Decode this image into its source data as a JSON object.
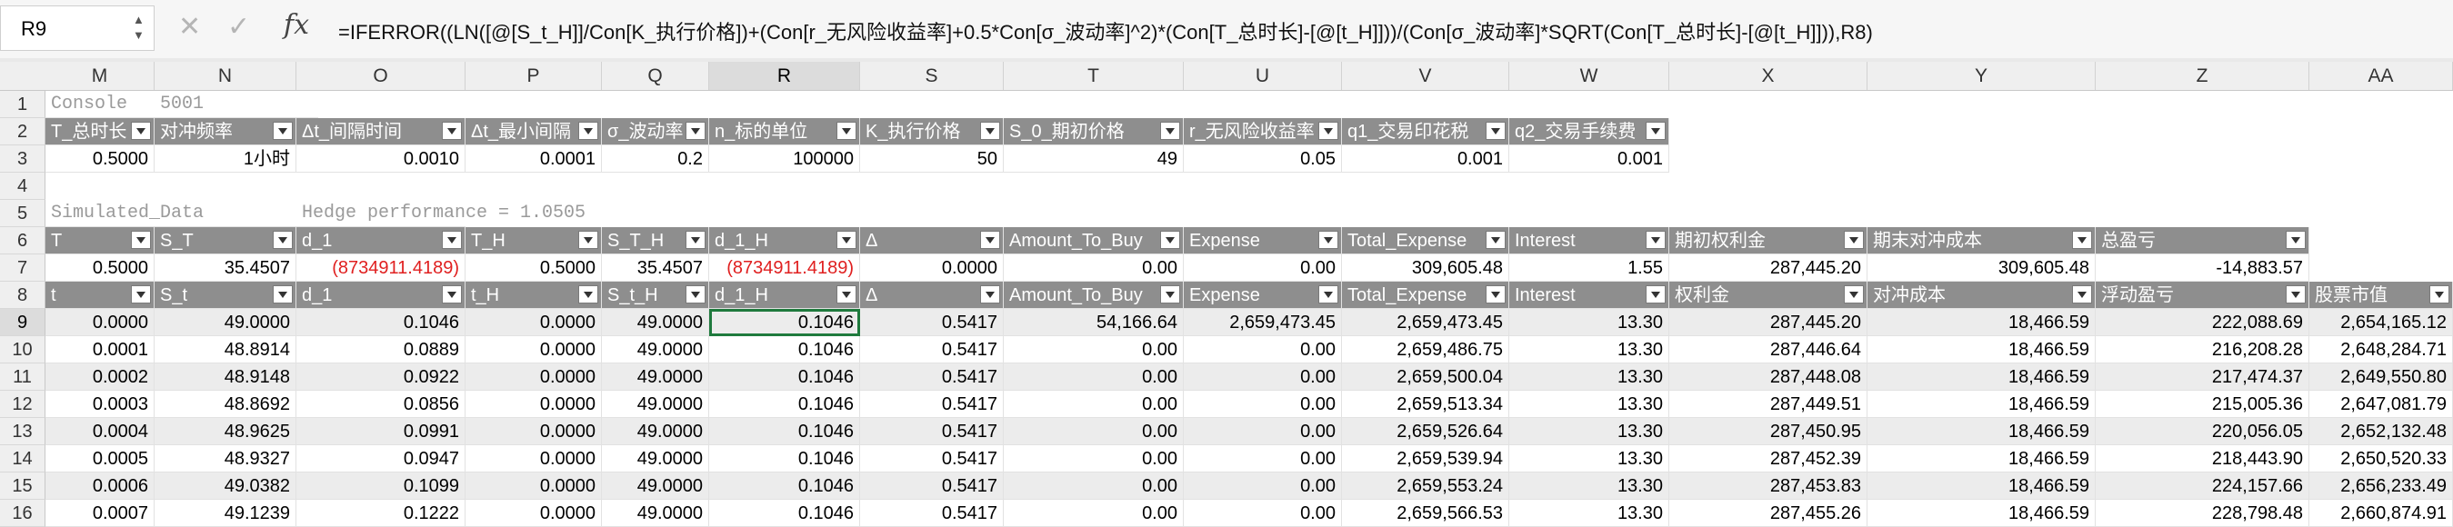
{
  "name_box": "R9",
  "formula_bar": {
    "cancel_glyph": "✕",
    "enter_glyph": "✓",
    "fx_label": "fx",
    "formula": "=IFERROR((LN([@[S_t_H]]/Con[K_执行价格])+(Con[r_无风险收益率]+0.5*Con[σ_波动率]^2)*(Con[T_总时长]-[@[t_H]]))/(Con[σ_波动率]*SQRT(Con[T_总时长]-[@[t_H]])),R8)"
  },
  "columns": [
    "M",
    "N",
    "O",
    "P",
    "Q",
    "R",
    "S",
    "T",
    "U",
    "V",
    "W",
    "X",
    "Y",
    "Z",
    "AA"
  ],
  "selected_column": "R",
  "rows": [
    {
      "num": "1",
      "cells": [
        {
          "col": "M",
          "text": "Console",
          "style": "mono"
        },
        {
          "col": "N",
          "text": "5001",
          "style": "mono"
        }
      ]
    },
    {
      "num": "2",
      "cells": [
        {
          "col": "M",
          "text": "T_总时长",
          "style": "hdr"
        },
        {
          "col": "N",
          "text": "对冲频率",
          "style": "hdr"
        },
        {
          "col": "O",
          "text": "Δt_间隔时间",
          "style": "hdr"
        },
        {
          "col": "P",
          "text": "Δt_最小间隔",
          "style": "hdr"
        },
        {
          "col": "Q",
          "text": "σ_波动率",
          "style": "hdr"
        },
        {
          "col": "R",
          "text": "n_标的单位",
          "style": "hdr"
        },
        {
          "col": "S",
          "text": "K_执行价格",
          "style": "hdr"
        },
        {
          "col": "T",
          "text": "S_0_期初价格",
          "style": "hdr"
        },
        {
          "col": "U",
          "text": "r_无风险收益率",
          "style": "hdr"
        },
        {
          "col": "V",
          "text": "q1_交易印花税",
          "style": "hdr"
        },
        {
          "col": "W",
          "text": "q2_交易手续费",
          "style": "hdr"
        }
      ]
    },
    {
      "num": "3",
      "cells": [
        {
          "col": "M",
          "text": "0.5000",
          "style": "num"
        },
        {
          "col": "N",
          "text": "1小时",
          "style": "num"
        },
        {
          "col": "O",
          "text": "0.0010",
          "style": "num"
        },
        {
          "col": "P",
          "text": "0.0001",
          "style": "num"
        },
        {
          "col": "Q",
          "text": "0.2",
          "style": "num"
        },
        {
          "col": "R",
          "text": "100000",
          "style": "num"
        },
        {
          "col": "S",
          "text": "50",
          "style": "num"
        },
        {
          "col": "T",
          "text": "49",
          "style": "num"
        },
        {
          "col": "U",
          "text": "0.05",
          "style": "num"
        },
        {
          "col": "V",
          "text": "0.001",
          "style": "num"
        },
        {
          "col": "W",
          "text": "0.001",
          "style": "num"
        }
      ]
    },
    {
      "num": "4",
      "cells": []
    },
    {
      "num": "5",
      "cells": [
        {
          "col": "M",
          "text": "Simulated_Data",
          "style": "mono"
        },
        {
          "col": "O",
          "text": "Hedge performance = 1.0505",
          "style": "mono"
        }
      ]
    },
    {
      "num": "6",
      "cells": [
        {
          "col": "M",
          "text": "T",
          "style": "hdr"
        },
        {
          "col": "N",
          "text": "S_T",
          "style": "hdr"
        },
        {
          "col": "O",
          "text": "d_1",
          "style": "hdr"
        },
        {
          "col": "P",
          "text": "T_H",
          "style": "hdr"
        },
        {
          "col": "Q",
          "text": "S_T_H",
          "style": "hdr"
        },
        {
          "col": "R",
          "text": "d_1_H",
          "style": "hdr"
        },
        {
          "col": "S",
          "text": "Δ",
          "style": "hdr"
        },
        {
          "col": "T",
          "text": "Amount_To_Buy",
          "style": "hdr"
        },
        {
          "col": "U",
          "text": "Expense",
          "style": "hdr"
        },
        {
          "col": "V",
          "text": "Total_Expense",
          "style": "hdr"
        },
        {
          "col": "W",
          "text": "Interest",
          "style": "hdr"
        },
        {
          "col": "X",
          "text": "期初权利金",
          "style": "hdr"
        },
        {
          "col": "Y",
          "text": "期末对冲成本",
          "style": "hdr"
        },
        {
          "col": "Z",
          "text": "总盈亏",
          "style": "hdr"
        }
      ]
    },
    {
      "num": "7",
      "cells": [
        {
          "col": "M",
          "text": "0.5000",
          "style": "num"
        },
        {
          "col": "N",
          "text": "35.4507",
          "style": "num"
        },
        {
          "col": "O",
          "text": "(8734911.4189)",
          "style": "red"
        },
        {
          "col": "P",
          "text": "0.5000",
          "style": "num"
        },
        {
          "col": "Q",
          "text": "35.4507",
          "style": "num"
        },
        {
          "col": "R",
          "text": "(8734911.4189)",
          "style": "red"
        },
        {
          "col": "S",
          "text": "0.0000",
          "style": "num"
        },
        {
          "col": "T",
          "text": "0.00",
          "style": "num"
        },
        {
          "col": "U",
          "text": "0.00",
          "style": "num"
        },
        {
          "col": "V",
          "text": "309,605.48",
          "style": "num"
        },
        {
          "col": "W",
          "text": "1.55",
          "style": "num"
        },
        {
          "col": "X",
          "text": "287,445.20",
          "style": "num"
        },
        {
          "col": "Y",
          "text": "309,605.48",
          "style": "num"
        },
        {
          "col": "Z",
          "text": "-14,883.57",
          "style": "num"
        }
      ]
    },
    {
      "num": "8",
      "cells": [
        {
          "col": "M",
          "text": "t",
          "style": "hdr"
        },
        {
          "col": "N",
          "text": "S_t",
          "style": "hdr"
        },
        {
          "col": "O",
          "text": "d_1",
          "style": "hdr"
        },
        {
          "col": "P",
          "text": "t_H",
          "style": "hdr"
        },
        {
          "col": "Q",
          "text": "S_t_H",
          "style": "hdr"
        },
        {
          "col": "R",
          "text": "d_1_H",
          "style": "hdr"
        },
        {
          "col": "S",
          "text": "Δ",
          "style": "hdr"
        },
        {
          "col": "T",
          "text": "Amount_To_Buy",
          "style": "hdr"
        },
        {
          "col": "U",
          "text": "Expense",
          "style": "hdr"
        },
        {
          "col": "V",
          "text": "Total_Expense",
          "style": "hdr"
        },
        {
          "col": "W",
          "text": "Interest",
          "style": "hdr"
        },
        {
          "col": "X",
          "text": "权利金",
          "style": "hdr"
        },
        {
          "col": "Y",
          "text": "对冲成本",
          "style": "hdr"
        },
        {
          "col": "Z",
          "text": "浮动盈亏",
          "style": "hdr"
        },
        {
          "col": "AA",
          "text": "股票市值",
          "style": "hdr"
        }
      ]
    },
    {
      "num": "9",
      "band": true,
      "cells": [
        {
          "col": "M",
          "text": "0.0000"
        },
        {
          "col": "N",
          "text": "49.0000"
        },
        {
          "col": "O",
          "text": "0.1046"
        },
        {
          "col": "P",
          "text": "0.0000"
        },
        {
          "col": "Q",
          "text": "49.0000"
        },
        {
          "col": "R",
          "text": "0.1046",
          "active": true
        },
        {
          "col": "S",
          "text": "0.5417"
        },
        {
          "col": "T",
          "text": "54,166.64"
        },
        {
          "col": "U",
          "text": "2,659,473.45"
        },
        {
          "col": "V",
          "text": "2,659,473.45"
        },
        {
          "col": "W",
          "text": "13.30"
        },
        {
          "col": "X",
          "text": "287,445.20"
        },
        {
          "col": "Y",
          "text": "18,466.59"
        },
        {
          "col": "Z",
          "text": "222,088.69"
        },
        {
          "col": "AA",
          "text": "2,654,165.12"
        }
      ]
    },
    {
      "num": "10",
      "cells": [
        {
          "col": "M",
          "text": "0.0001"
        },
        {
          "col": "N",
          "text": "48.8914"
        },
        {
          "col": "O",
          "text": "0.0889"
        },
        {
          "col": "P",
          "text": "0.0000"
        },
        {
          "col": "Q",
          "text": "49.0000"
        },
        {
          "col": "R",
          "text": "0.1046"
        },
        {
          "col": "S",
          "text": "0.5417"
        },
        {
          "col": "T",
          "text": "0.00"
        },
        {
          "col": "U",
          "text": "0.00"
        },
        {
          "col": "V",
          "text": "2,659,486.75"
        },
        {
          "col": "W",
          "text": "13.30"
        },
        {
          "col": "X",
          "text": "287,446.64"
        },
        {
          "col": "Y",
          "text": "18,466.59"
        },
        {
          "col": "Z",
          "text": "216,208.28"
        },
        {
          "col": "AA",
          "text": "2,648,284.71"
        }
      ]
    },
    {
      "num": "11",
      "band": true,
      "cells": [
        {
          "col": "M",
          "text": "0.0002"
        },
        {
          "col": "N",
          "text": "48.9148"
        },
        {
          "col": "O",
          "text": "0.0922"
        },
        {
          "col": "P",
          "text": "0.0000"
        },
        {
          "col": "Q",
          "text": "49.0000"
        },
        {
          "col": "R",
          "text": "0.1046"
        },
        {
          "col": "S",
          "text": "0.5417"
        },
        {
          "col": "T",
          "text": "0.00"
        },
        {
          "col": "U",
          "text": "0.00"
        },
        {
          "col": "V",
          "text": "2,659,500.04"
        },
        {
          "col": "W",
          "text": "13.30"
        },
        {
          "col": "X",
          "text": "287,448.08"
        },
        {
          "col": "Y",
          "text": "18,466.59"
        },
        {
          "col": "Z",
          "text": "217,474.37"
        },
        {
          "col": "AA",
          "text": "2,649,550.80"
        }
      ]
    },
    {
      "num": "12",
      "cells": [
        {
          "col": "M",
          "text": "0.0003"
        },
        {
          "col": "N",
          "text": "48.8692"
        },
        {
          "col": "O",
          "text": "0.0856"
        },
        {
          "col": "P",
          "text": "0.0000"
        },
        {
          "col": "Q",
          "text": "49.0000"
        },
        {
          "col": "R",
          "text": "0.1046"
        },
        {
          "col": "S",
          "text": "0.5417"
        },
        {
          "col": "T",
          "text": "0.00"
        },
        {
          "col": "U",
          "text": "0.00"
        },
        {
          "col": "V",
          "text": "2,659,513.34"
        },
        {
          "col": "W",
          "text": "13.30"
        },
        {
          "col": "X",
          "text": "287,449.51"
        },
        {
          "col": "Y",
          "text": "18,466.59"
        },
        {
          "col": "Z",
          "text": "215,005.36"
        },
        {
          "col": "AA",
          "text": "2,647,081.79"
        }
      ]
    },
    {
      "num": "13",
      "band": true,
      "cells": [
        {
          "col": "M",
          "text": "0.0004"
        },
        {
          "col": "N",
          "text": "48.9625"
        },
        {
          "col": "O",
          "text": "0.0991"
        },
        {
          "col": "P",
          "text": "0.0000"
        },
        {
          "col": "Q",
          "text": "49.0000"
        },
        {
          "col": "R",
          "text": "0.1046"
        },
        {
          "col": "S",
          "text": "0.5417"
        },
        {
          "col": "T",
          "text": "0.00"
        },
        {
          "col": "U",
          "text": "0.00"
        },
        {
          "col": "V",
          "text": "2,659,526.64"
        },
        {
          "col": "W",
          "text": "13.30"
        },
        {
          "col": "X",
          "text": "287,450.95"
        },
        {
          "col": "Y",
          "text": "18,466.59"
        },
        {
          "col": "Z",
          "text": "220,056.05"
        },
        {
          "col": "AA",
          "text": "2,652,132.48"
        }
      ]
    },
    {
      "num": "14",
      "cells": [
        {
          "col": "M",
          "text": "0.0005"
        },
        {
          "col": "N",
          "text": "48.9327"
        },
        {
          "col": "O",
          "text": "0.0947"
        },
        {
          "col": "P",
          "text": "0.0000"
        },
        {
          "col": "Q",
          "text": "49.0000"
        },
        {
          "col": "R",
          "text": "0.1046"
        },
        {
          "col": "S",
          "text": "0.5417"
        },
        {
          "col": "T",
          "text": "0.00"
        },
        {
          "col": "U",
          "text": "0.00"
        },
        {
          "col": "V",
          "text": "2,659,539.94"
        },
        {
          "col": "W",
          "text": "13.30"
        },
        {
          "col": "X",
          "text": "287,452.39"
        },
        {
          "col": "Y",
          "text": "18,466.59"
        },
        {
          "col": "Z",
          "text": "218,443.90"
        },
        {
          "col": "AA",
          "text": "2,650,520.33"
        }
      ]
    },
    {
      "num": "15",
      "band": true,
      "cells": [
        {
          "col": "M",
          "text": "0.0006"
        },
        {
          "col": "N",
          "text": "49.0382"
        },
        {
          "col": "O",
          "text": "0.1099"
        },
        {
          "col": "P",
          "text": "0.0000"
        },
        {
          "col": "Q",
          "text": "49.0000"
        },
        {
          "col": "R",
          "text": "0.1046"
        },
        {
          "col": "S",
          "text": "0.5417"
        },
        {
          "col": "T",
          "text": "0.00"
        },
        {
          "col": "U",
          "text": "0.00"
        },
        {
          "col": "V",
          "text": "2,659,553.24"
        },
        {
          "col": "W",
          "text": "13.30"
        },
        {
          "col": "X",
          "text": "287,453.83"
        },
        {
          "col": "Y",
          "text": "18,466.59"
        },
        {
          "col": "Z",
          "text": "224,157.66"
        },
        {
          "col": "AA",
          "text": "2,656,233.49"
        }
      ]
    },
    {
      "num": "16",
      "cells": [
        {
          "col": "M",
          "text": "0.0007"
        },
        {
          "col": "N",
          "text": "49.1239"
        },
        {
          "col": "O",
          "text": "0.1222"
        },
        {
          "col": "P",
          "text": "0.0000"
        },
        {
          "col": "Q",
          "text": "49.0000"
        },
        {
          "col": "R",
          "text": "0.1046"
        },
        {
          "col": "S",
          "text": "0.5417"
        },
        {
          "col": "T",
          "text": "0.00"
        },
        {
          "col": "U",
          "text": "0.00"
        },
        {
          "col": "V",
          "text": "2,659,566.53"
        },
        {
          "col": "W",
          "text": "13.30"
        },
        {
          "col": "X",
          "text": "287,455.26"
        },
        {
          "col": "Y",
          "text": "18,466.59"
        },
        {
          "col": "Z",
          "text": "228,798.48"
        },
        {
          "col": "AA",
          "text": "2,660,874.91"
        }
      ]
    }
  ]
}
